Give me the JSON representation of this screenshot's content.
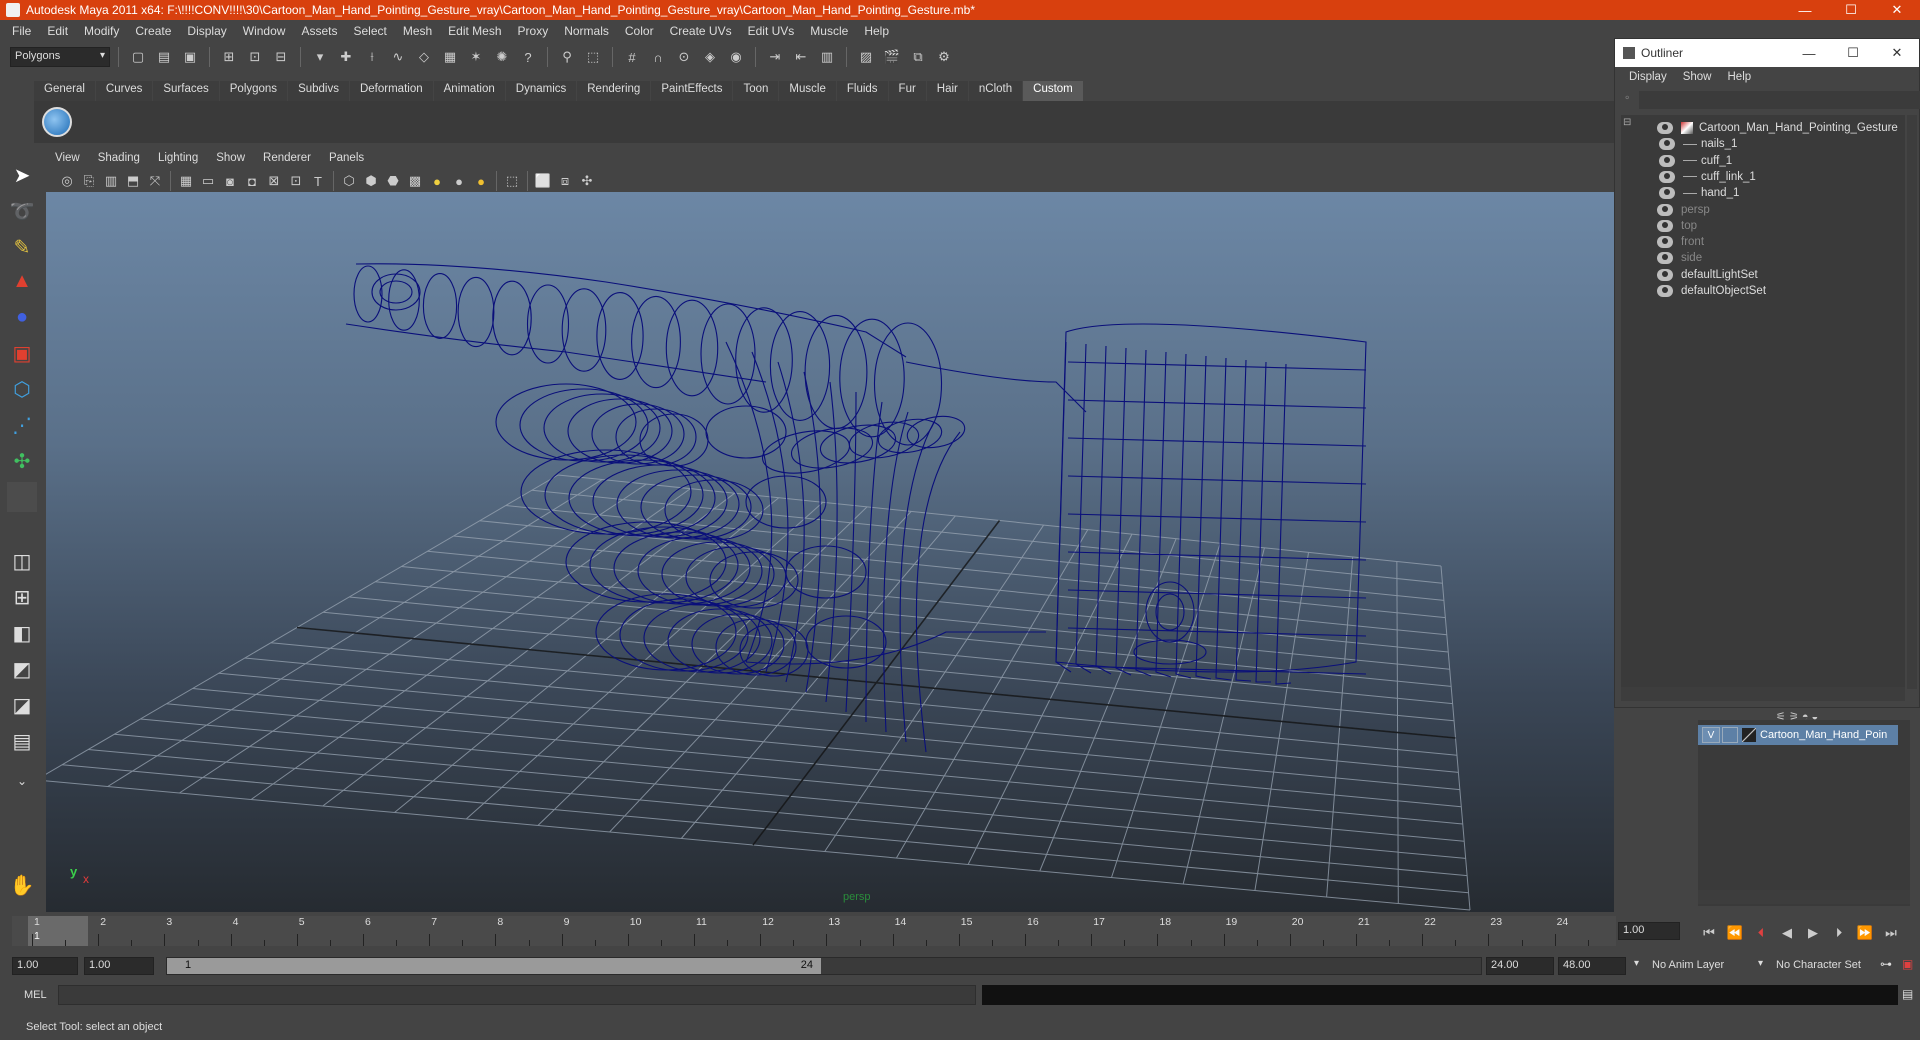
{
  "window": {
    "title": "Autodesk Maya 2011 x64: F:\\!!!!CONV!!!!\\30\\Cartoon_Man_Hand_Pointing_Gesture_vray\\Cartoon_Man_Hand_Pointing_Gesture_vray\\Cartoon_Man_Hand_Pointing_Gesture.mb*",
    "min": "—",
    "max": "☐",
    "close": "✕"
  },
  "menubar": [
    "File",
    "Edit",
    "Modify",
    "Create",
    "Display",
    "Window",
    "Assets",
    "Select",
    "Mesh",
    "Edit Mesh",
    "Proxy",
    "Normals",
    "Color",
    "Create UVs",
    "Edit UVs",
    "Muscle",
    "Help"
  ],
  "status": {
    "mode": "Polygons"
  },
  "shelf_tabs": [
    {
      "label": "General"
    },
    {
      "label": "Curves"
    },
    {
      "label": "Surfaces"
    },
    {
      "label": "Polygons"
    },
    {
      "label": "Subdivs"
    },
    {
      "label": "Deformation"
    },
    {
      "label": "Animation"
    },
    {
      "label": "Dynamics"
    },
    {
      "label": "Rendering"
    },
    {
      "label": "PaintEffects"
    },
    {
      "label": "Toon"
    },
    {
      "label": "Muscle"
    },
    {
      "label": "Fluids"
    },
    {
      "label": "Fur"
    },
    {
      "label": "Hair"
    },
    {
      "label": "nCloth"
    },
    {
      "label": "Custom",
      "active": true
    }
  ],
  "panel_menu": [
    "View",
    "Shading",
    "Lighting",
    "Show",
    "Renderer",
    "Panels"
  ],
  "viewport": {
    "camera_label": "persp",
    "axis_x": "x",
    "axis_y": "y"
  },
  "timeline": {
    "ticks": [
      "1",
      "2",
      "3",
      "4",
      "5",
      "6",
      "7",
      "8",
      "9",
      "10",
      "11",
      "12",
      "13",
      "14",
      "15",
      "16",
      "17",
      "18",
      "19",
      "20",
      "21",
      "22",
      "23",
      "24"
    ],
    "current_frame": "1",
    "current_time_field": "1.00"
  },
  "range": {
    "start_field": "1.00",
    "playback_start": "1.00",
    "slider_start": "1",
    "slider_end": "24",
    "playback_end": "24.00",
    "end_field": "48.00",
    "anim_layer": "No Anim Layer",
    "character_set": "No Character Set"
  },
  "mel": {
    "label": "MEL"
  },
  "helpline": "Select Tool: select an object",
  "outliner": {
    "title": "Outliner",
    "menu": [
      "Display",
      "Show",
      "Help"
    ],
    "items": [
      {
        "label": "Cartoon_Man_Hand_Pointing_Gesture",
        "indent": 0,
        "dim": false
      },
      {
        "label": "nails_1",
        "indent": 1,
        "dim": false
      },
      {
        "label": "cuff_1",
        "indent": 1,
        "dim": false
      },
      {
        "label": "cuff_link_1",
        "indent": 1,
        "dim": false
      },
      {
        "label": "hand_1",
        "indent": 1,
        "dim": false
      },
      {
        "label": "persp",
        "indent": 0,
        "dim": true
      },
      {
        "label": "top",
        "indent": 0,
        "dim": true
      },
      {
        "label": "front",
        "indent": 0,
        "dim": true
      },
      {
        "label": "side",
        "indent": 0,
        "dim": true
      },
      {
        "label": "defaultLightSet",
        "indent": 0,
        "dim": false
      },
      {
        "label": "defaultObjectSet",
        "indent": 0,
        "dim": false
      }
    ]
  },
  "layers": {
    "visible": "V",
    "name": "Cartoon_Man_Hand_Poin"
  },
  "colors": {
    "title_bar": "#d8400e",
    "wireframe": "#0a0f7a",
    "layer_selected": "#5d80a6"
  }
}
